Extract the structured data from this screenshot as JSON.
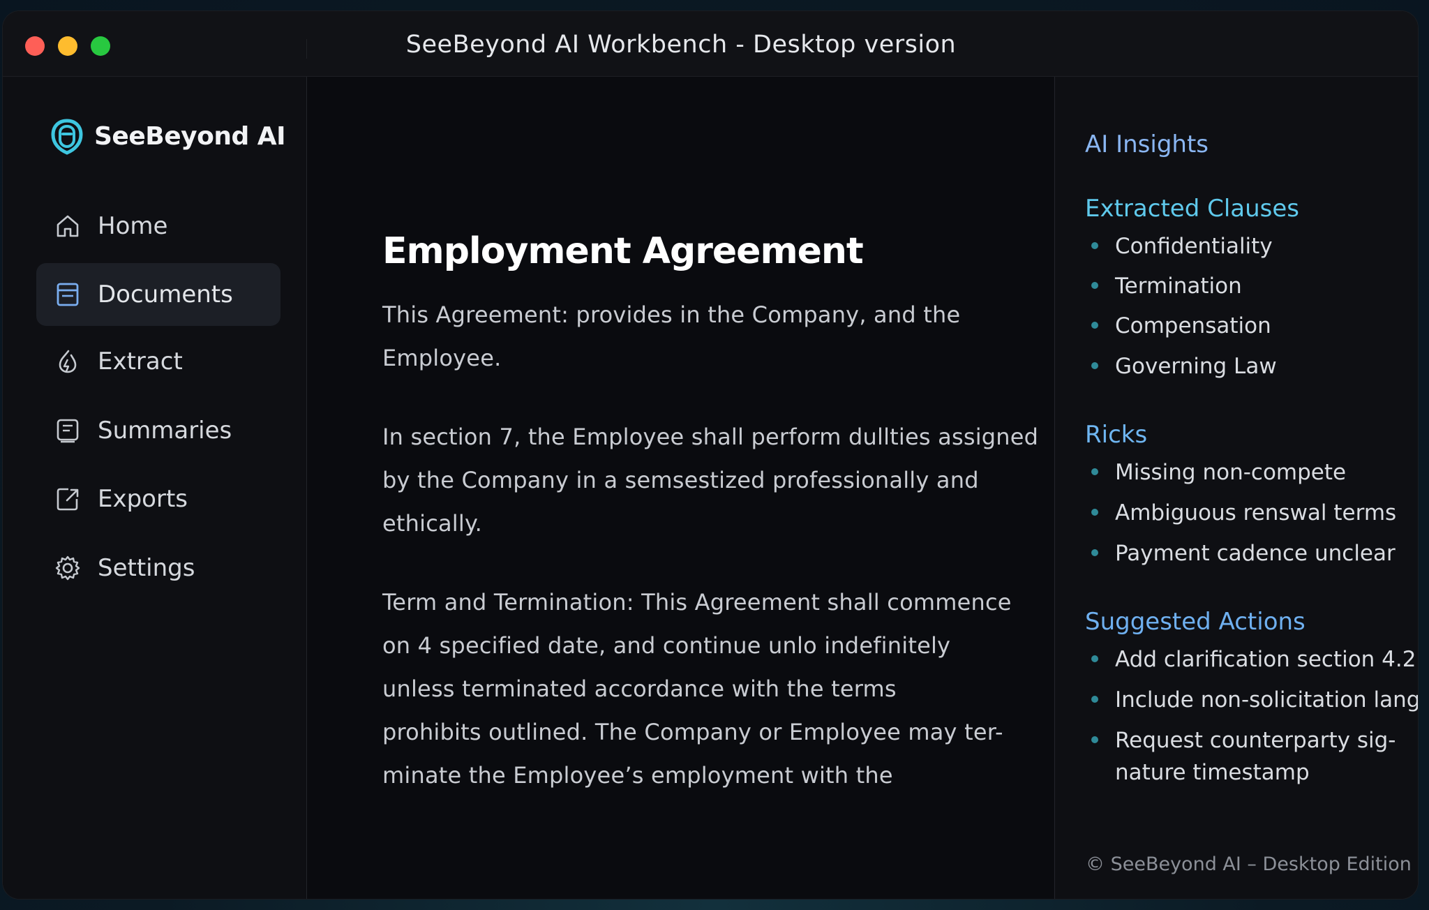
{
  "window": {
    "title": "SeeBeyond AI Workbench - Desktop version"
  },
  "brand": {
    "name": "SeeBeyond AI",
    "icon": "brand-logo-icon",
    "accent": "#3ec6e0"
  },
  "sidebar": {
    "active_item": "Documents",
    "items": [
      {
        "label": "Home",
        "icon": "home-icon"
      },
      {
        "label": "Documents",
        "icon": "document-icon"
      },
      {
        "label": "Extract",
        "icon": "extract-icon"
      },
      {
        "label": "Summaries",
        "icon": "summary-icon"
      },
      {
        "label": "Exports",
        "icon": "export-icon"
      },
      {
        "label": "Settings",
        "icon": "gear-icon"
      }
    ]
  },
  "document": {
    "title": "Employment Agreement",
    "paragraphs": [
      {
        "lines": [
          "This Agreement: provides in the Company, and the",
          "Employee."
        ]
      },
      {
        "lines": [
          "In section 7, the Employee shall perform dullties assigned",
          "by the Company in a semsestized professionally and",
          "ethically."
        ]
      },
      {
        "lines": [
          "Term and Termination: This Agreement shall commence",
          "on 4 specified date, and continue unlo indefinitely",
          "unless terminated accordance with the terms",
          "prohibits outlined. The Company or Employee may ter-",
          "minate the Employee’s employment with the"
        ]
      }
    ]
  },
  "insights": {
    "heading": "AI Insights",
    "extracted_clauses": {
      "heading": "Extracted Clauses",
      "items": [
        "Confidentiality",
        "Termination",
        "Compensation",
        "Governing Law"
      ]
    },
    "risks": {
      "heading": "Ricks",
      "items": [
        "Missing non-compete",
        "Ambiguous renswal terms",
        "Payment cadence unclear"
      ]
    },
    "suggested_actions": {
      "heading": "Suggested Actions",
      "items": [
        {
          "lines": [
            "Add clarification section 4.2"
          ]
        },
        {
          "lines": [
            "Include non-solicitation lang"
          ]
        },
        {
          "lines": [
            "Request counterparty sig-",
            "nature timestamp"
          ]
        }
      ]
    },
    "footer": "© SeeBeyond AI – Desktop Edition"
  },
  "colors": {
    "window_bg": "#0c0d11",
    "sidebar_bg": "#0e0f13",
    "active_nav_bg": "#1c1f26",
    "heading_blue": "#6fb0f0",
    "heading_cyan": "#5fc9ec",
    "bullet": "#2f8a98",
    "close": "#fe5f57",
    "minimize": "#febc2e",
    "maximize": "#28c840"
  }
}
